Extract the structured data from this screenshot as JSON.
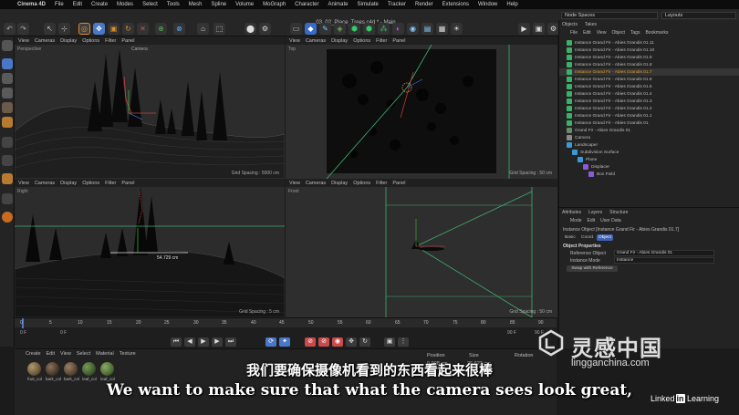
{
  "menubar": {
    "app": "Cinema 4D",
    "items": [
      "File",
      "Edit",
      "Create",
      "Modes",
      "Select",
      "Tools",
      "Mesh",
      "Spline",
      "Volume",
      "MoGraph",
      "Character",
      "Animate",
      "Simulate",
      "Tracker",
      "Render",
      "Extensions",
      "Window",
      "Help"
    ]
  },
  "toolbar": {
    "doc_title": "03_02_Place_Trees.c4d * - Main",
    "node_spaces": "Node Spaces",
    "layouts": "Layouts"
  },
  "viewports": {
    "perspective": {
      "menu": [
        "View",
        "Cameras",
        "Display",
        "Options",
        "Filter",
        "Panel"
      ],
      "label": "Perspective",
      "camera_label": "Camera",
      "grid": "Grid Spacing : 5000 cm"
    },
    "top": {
      "menu": [
        "View",
        "Cameras",
        "Display",
        "Options",
        "Filter",
        "Panel"
      ],
      "label": "Top",
      "grid": "Grid Spacing : 50 cm"
    },
    "right": {
      "menu": [
        "View",
        "Cameras",
        "Display",
        "Options",
        "Filter",
        "Panel"
      ],
      "label": "Right",
      "measure": "54.729 cm",
      "grid": "Grid Spacing : 5 cm"
    },
    "front": {
      "menu": [
        "View",
        "Cameras",
        "Display",
        "Options",
        "Filter",
        "Panel"
      ],
      "label": "Front",
      "grid": "Grid Spacing : 50 cm"
    }
  },
  "timeline": {
    "ticks": [
      "0",
      "5",
      "10",
      "15",
      "20",
      "25",
      "30",
      "35",
      "40",
      "45",
      "50",
      "55",
      "60",
      "65",
      "70",
      "75",
      "80",
      "85",
      "90"
    ],
    "start_frame": "0 F",
    "current_frame": "0 F",
    "end_frame": "90 F",
    "end_frame_b": "90 F"
  },
  "materials": {
    "menu": [
      "Create",
      "Edit",
      "View",
      "Select",
      "Material",
      "Texture"
    ],
    "items": [
      {
        "label": "fruit_col",
        "color": "#6b5a3a"
      },
      {
        "label": "bark_col",
        "color": "#4a3a2a"
      },
      {
        "label": "bark_col",
        "color": "#5a4633"
      },
      {
        "label": "leaf_col",
        "color": "#3f5a2e"
      },
      {
        "label": "leaf_col",
        "color": "#4d6b35"
      }
    ],
    "coord_headers": [
      "Position",
      "Size",
      "Rotation"
    ],
    "coords": [
      "0.908 cm",
      "26.623 cm"
    ]
  },
  "object_manager": {
    "tabs": [
      "Objects",
      "Takes"
    ],
    "menu": [
      "File",
      "Edit",
      "View",
      "Object",
      "Tags",
      "Bookmarks"
    ],
    "rows": [
      {
        "name": "Instance Grand Fir - Abies Grandis 01.11",
        "color": "#3ab06a"
      },
      {
        "name": "Instance Grand Fir - Abies Grandis 01.10",
        "color": "#3ab06a"
      },
      {
        "name": "Instance Grand Fir - Abies Grandis 01.9",
        "color": "#3ab06a"
      },
      {
        "name": "Instance Grand Fir - Abies Grandis 01.8",
        "color": "#3ab06a"
      },
      {
        "name": "Instance Grand Fir - Abies Grandis 01.7",
        "color": "#d8a030"
      },
      {
        "name": "Instance Grand Fir - Abies Grandis 01.6",
        "color": "#3ab06a"
      },
      {
        "name": "Instance Grand Fir - Abies Grandis 01.5",
        "color": "#3ab06a"
      },
      {
        "name": "Instance Grand Fir - Abies Grandis 01.4",
        "color": "#3ab06a"
      },
      {
        "name": "Instance Grand Fir - Abies Grandis 01.3",
        "color": "#3ab06a"
      },
      {
        "name": "Instance Grand Fir - Abies Grandis 01.2",
        "color": "#3ab06a"
      },
      {
        "name": "Instance Grand Fir - Abies Grandis 01.1",
        "color": "#3ab06a"
      },
      {
        "name": "Instance Grand Fir - Abies Grandis 01",
        "color": "#3ab06a"
      },
      {
        "name": "Grand Fir - Abies Grandis 01",
        "color": "#6a8a6a"
      },
      {
        "name": "Camera",
        "color": "#8a8a8a"
      },
      {
        "name": "Landscaper",
        "color": "#3a9ad8"
      },
      {
        "name": "Subdivision Surface",
        "color": "#3a9ad8"
      },
      {
        "name": "Plane",
        "color": "#3a9ad8"
      },
      {
        "name": "Displacer",
        "color": "#8a5ad8"
      },
      {
        "name": "Box Field",
        "color": "#8a5ad8"
      }
    ]
  },
  "attribute_manager": {
    "tabs": [
      "Attributes",
      "Layers",
      "Structure"
    ],
    "menu": [
      "Mode",
      "Edit",
      "User Data"
    ],
    "object_title": "Instance Object [Instance Grand Fir - Abies Grandis 01.7]",
    "subtabs": [
      "Basic",
      "Coord.",
      "Object"
    ],
    "section": "Object Properties",
    "reference_label": "Reference Object",
    "reference_value": "Grand Fir - Abies Grandis 01",
    "mode_label": "Instance Mode",
    "mode_value": "Instance",
    "swap_button": "Swap with Reference"
  },
  "subtitles": {
    "cn": "我们要确保摄像机看到的东西看起来很棒",
    "en": "We want to make sure that what the camera sees look great,"
  },
  "watermark": {
    "cn": "灵感中国",
    "en": "lingganchina.com",
    "linkedin_a": "Linked",
    "linkedin_b": "in",
    "linkedin_c": " Learning"
  }
}
